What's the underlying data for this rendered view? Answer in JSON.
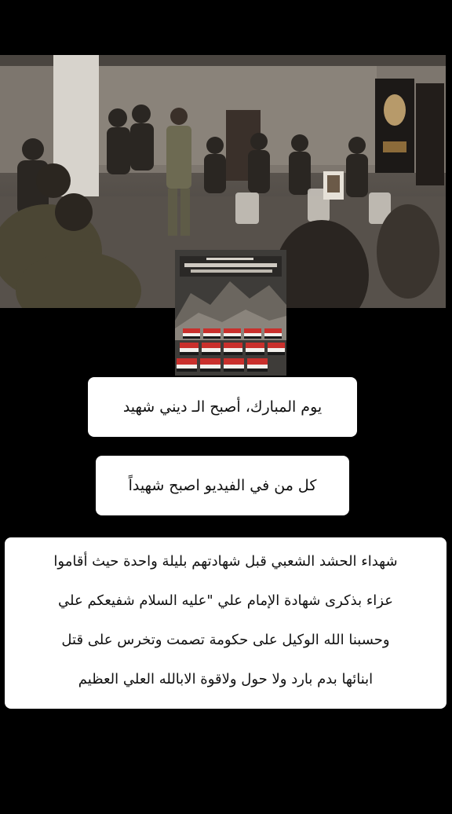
{
  "video": {
    "scene": "room-gathering-photo",
    "thumbnail_scene": "memorial-coffins-image"
  },
  "captions": {
    "line1": "يوم المبارك، أصبح الـ ديني شهيد",
    "line2": "كل من في الفيديو اصبح شهيداً",
    "paragraph": [
      "شهداء الحشد الشعبي قبل شهادتهم بليلة واحدة حيث أقاموا",
      "عزاء بذكرى شهادة الإمام علي \"عليه السلام  شفيعكم علي",
      "وحسبنا الله الوكيل على حكومة تصمت وتخرس على قتل",
      "ابنائها بدم بارد ولا حول ولاقوة الابالله العلي العظيم"
    ]
  },
  "colors": {
    "background": "#000000",
    "caption_bg": "#ffffff",
    "caption_text": "#111111"
  }
}
